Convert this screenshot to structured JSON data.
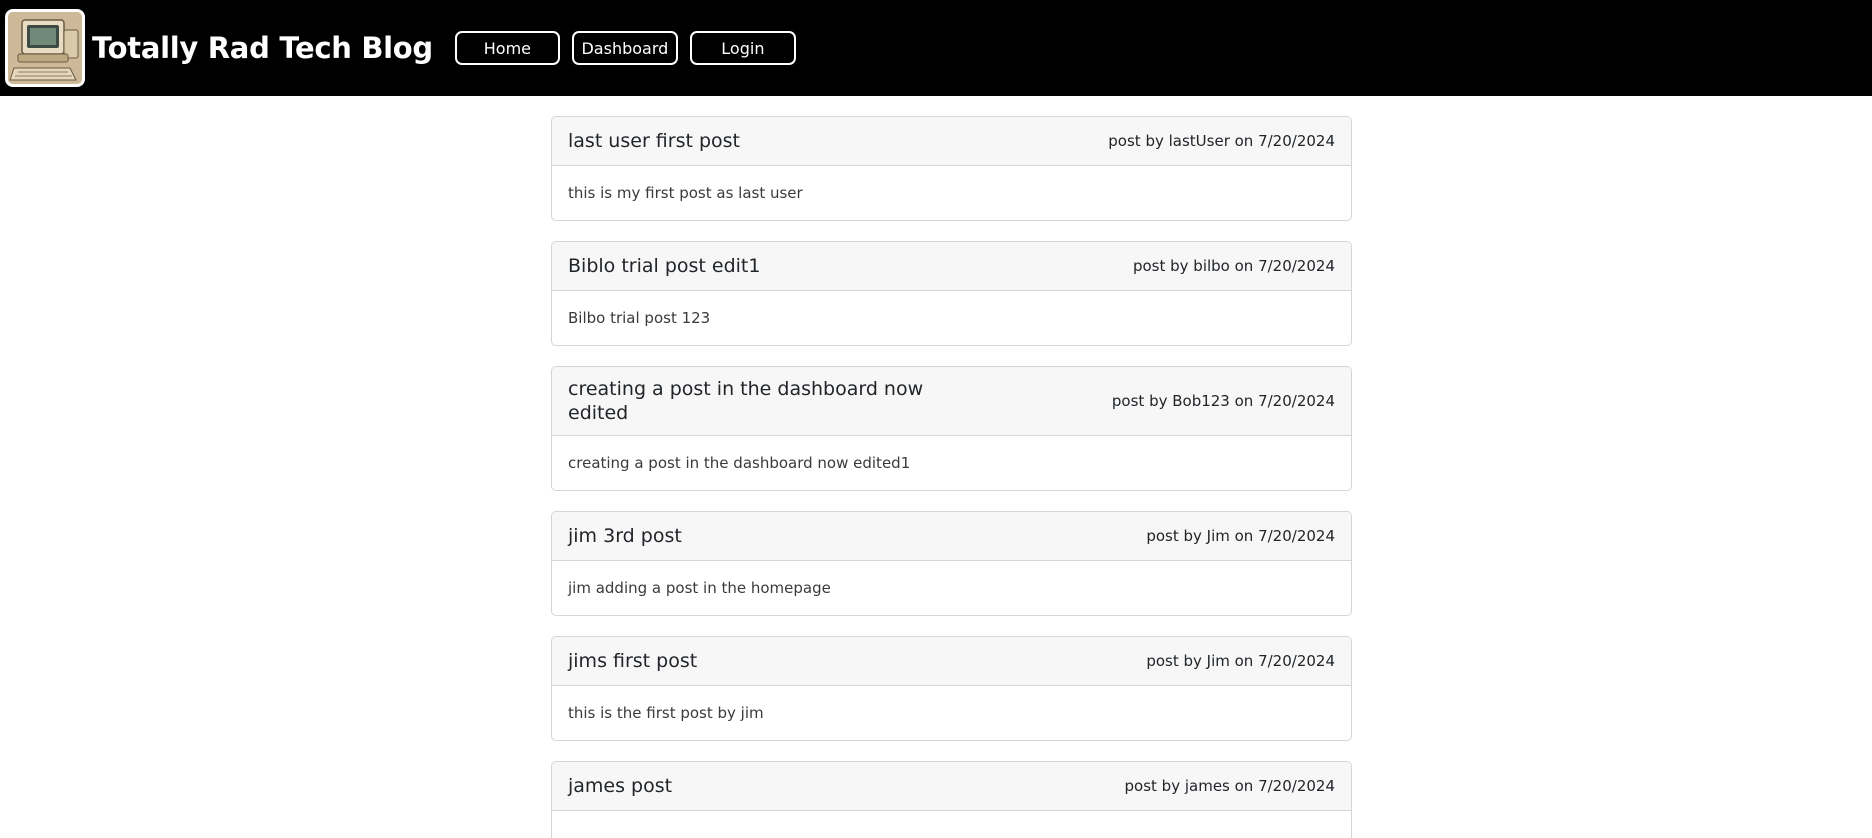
{
  "header": {
    "site_title": "Totally Rad Tech Blog",
    "logo_icon": "retro-computer-icon",
    "nav": {
      "home_label": "Home",
      "dashboard_label": "Dashboard",
      "login_label": "Login"
    }
  },
  "posts": [
    {
      "title": "last user first post",
      "meta": "post by lastUser on 7/20/2024",
      "body": "this is my first post as last user"
    },
    {
      "title": "Biblo trial post edit1",
      "meta": "post by bilbo on 7/20/2024",
      "body": "Bilbo trial post 123"
    },
    {
      "title": "creating a post in the dashboard now edited",
      "meta": "post by Bob123 on 7/20/2024",
      "body": "creating a post in the dashboard now edited1"
    },
    {
      "title": "jim 3rd post",
      "meta": "post by Jim on 7/20/2024",
      "body": "jim adding a post in the homepage"
    },
    {
      "title": "jims first post",
      "meta": "post by Jim on 7/20/2024",
      "body": "this is the first post by jim"
    },
    {
      "title": "james post",
      "meta": "post by james on 7/20/2024",
      "body": ""
    }
  ],
  "colors": {
    "header_bg": "#000000",
    "header_text": "#ffffff",
    "card_header_bg": "#f7f7f7",
    "card_border": "#d5d5d5"
  }
}
